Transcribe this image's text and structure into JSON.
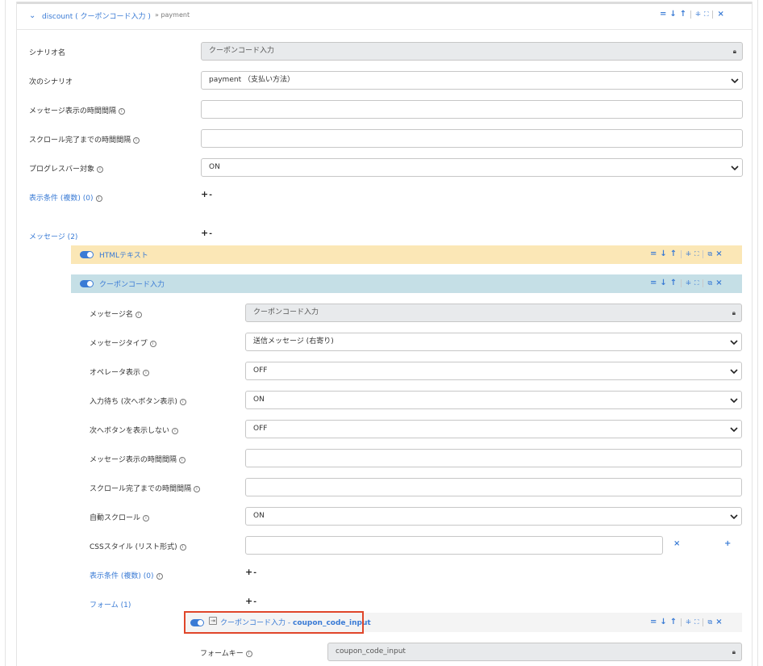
{
  "header": {
    "title": "discount ( クーポンコード入力 )",
    "sub": "» payment"
  },
  "scenario": {
    "name_label": "シナリオ名",
    "name_value": "クーポンコード入力",
    "next_label": "次のシナリオ",
    "next_value": "payment （支払い方法）",
    "interval_label": "メッセージ表示の時間間隔",
    "interval_value": "",
    "scroll_label": "スクロール完了までの時間間隔",
    "scroll_value": "",
    "progress_label": "プログレスバー対象",
    "progress_value": "ON",
    "conditions_label": "表示条件 (複数) (0)",
    "messages_label": "メッセージ (2)"
  },
  "messages": [
    {
      "title": "HTMLテキスト"
    },
    {
      "title": "クーポンコード入力"
    }
  ],
  "message_form": {
    "name_label": "メッセージ名",
    "name_value": "クーポンコード入力",
    "type_label": "メッセージタイプ",
    "type_value": "送信メッセージ (右寄り)",
    "operator_label": "オペレータ表示",
    "operator_value": "OFF",
    "wait_label": "入力待ち (次へボタン表示)",
    "wait_value": "ON",
    "hide_next_label": "次へボタンを表示しない",
    "hide_next_value": "OFF",
    "interval_label": "メッセージ表示の時間間隔",
    "interval_value": "",
    "scroll_label": "スクロール完了までの時間間隔",
    "scroll_value": "",
    "autoscroll_label": "自動スクロール",
    "autoscroll_value": "ON",
    "css_label": "CSSスタイル (リスト形式)",
    "css_value": "",
    "conditions_label": "表示条件 (複数) (0)",
    "forms_label": "フォーム (1)"
  },
  "form_item": {
    "title": "クーポンコード入力 - ",
    "key": "coupon_code_input",
    "key_label": "フォームキー",
    "key_value": "coupon_code_input"
  },
  "icons": {
    "collapse": "chevron-down-icon",
    "lock": "lock-icon",
    "info": "info-icon",
    "caret": "select-caret-icon",
    "toggle": "toggle-switch-icon"
  },
  "colors": {
    "accent": "#3a7bd5",
    "yellow_bar": "#fbe7b6",
    "blue_bar": "#c5dfe6",
    "highlight": "#e0462a"
  }
}
